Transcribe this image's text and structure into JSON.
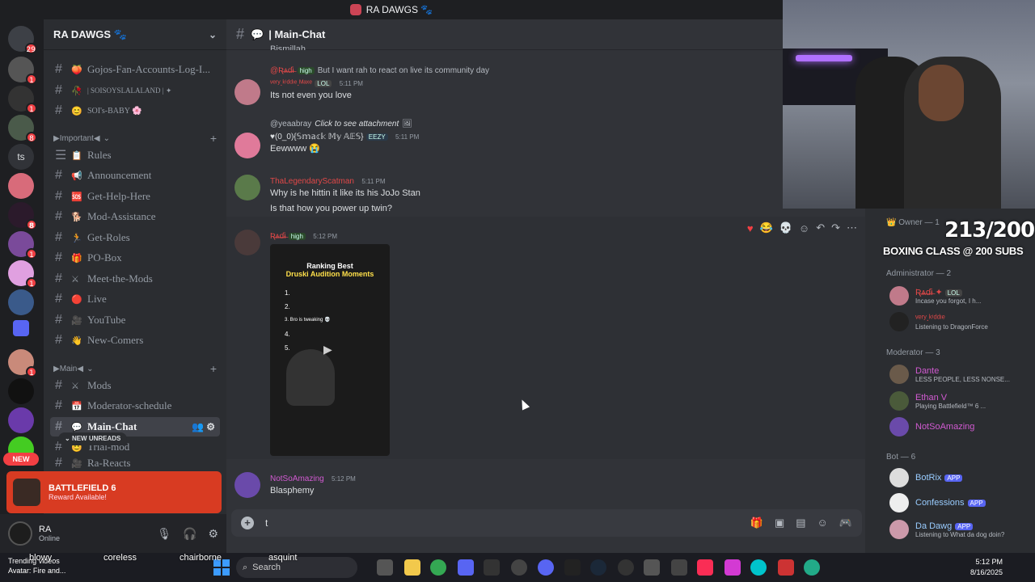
{
  "window": {
    "server_title": "RA DAWGS 🐾"
  },
  "servers": [
    {
      "badge": "29"
    },
    {
      "badge": "1"
    },
    {
      "badge": "1"
    },
    {
      "badge": "8"
    },
    {
      "badge": ""
    },
    {
      "badge": ""
    },
    {
      "badge": "8"
    },
    {
      "badge": "1"
    },
    {
      "badge": "1"
    },
    {
      "badge": ""
    },
    {
      "badge": ""
    },
    {
      "badge": "1"
    },
    {
      "badge": ""
    },
    {
      "badge": ""
    },
    {
      "badge": ""
    }
  ],
  "rail_text": {
    "ts": "ts",
    "new": "NEW"
  },
  "guild": {
    "name": "RA DAWGS 🐾"
  },
  "channels": [
    {
      "emoji": "🍑",
      "name": "Gojos-Fan-Accounts-Log-I..."
    },
    {
      "emoji": "🥀",
      "name": "| SOISOYSLALALAND | ✦"
    },
    {
      "emoji": "😊",
      "name": "SOI's-BABY 🌸"
    }
  ],
  "cat_important": "▶Important◀",
  "important_channels": [
    {
      "emoji": "📋",
      "name": "Rules"
    },
    {
      "emoji": "📢",
      "name": "Announcement"
    },
    {
      "emoji": "🆘",
      "name": "Get-Help-Here"
    },
    {
      "emoji": "🐕",
      "name": "Mod-Assistance"
    },
    {
      "emoji": "🏃",
      "name": "Get-Roles"
    },
    {
      "emoji": "🎁",
      "name": "PO-Box"
    },
    {
      "emoji": "⚔",
      "name": "Meet-the-Mods"
    },
    {
      "emoji": "🔴",
      "name": "Live"
    },
    {
      "emoji": "🎥",
      "name": "YouTube"
    },
    {
      "emoji": "👋",
      "name": "New-Comers"
    }
  ],
  "cat_main": "▶Main◀",
  "main_channels": [
    {
      "emoji": "⚔",
      "name": "Mods"
    },
    {
      "emoji": "📅",
      "name": "Moderator-schedule"
    },
    {
      "emoji": "💬",
      "name": "Main-Chat"
    },
    {
      "emoji": "😊",
      "name": "Trial-mod"
    },
    {
      "emoji": "🎥",
      "name": "Ra-Reacts"
    }
  ],
  "new_unreads": "NEW UNREADS",
  "promo": {
    "title": "BATTLEFIELD 6",
    "sub": "Reward Available!"
  },
  "user": {
    "name": "RA",
    "status": "Online"
  },
  "channel_header": "| Main-Chat",
  "messages": {
    "m0_text": "Bismillah",
    "m1_reply_user": "@Ʀ̶ѧ̶ɗ̶ɨ̶",
    "m1_reply_tag": "high",
    "m1_reply_text": "But I want rah to react on live its community day",
    "m1_user": "ᵛᵉʳʸ.ᵏⁱᵈᵈᶦᵉ.ᴹᵃˣᵉ",
    "m1_tag": "LOL",
    "m1_time": "5:11 PM",
    "m1_text": "Its not even you love",
    "m2_reply_user": "@yeaabray",
    "m2_reply_text": "Click to see attachment",
    "m2_user": "♥(0_0){𝕊𝕞𝕒𝕔𝕜 𝕄𝕪 𝔸𝔼𝕊}",
    "m2_tag": "EEZY",
    "m2_time": "5:11 PM",
    "m2_text": "Eewwww 😭",
    "m3_user": "ThaLegendaryScatman",
    "m3_time": "5:11 PM",
    "m3_text1": "Why is he hittin it like its his JoJo Stan",
    "m3_text2": "Is that how you power up twin?",
    "m4_user": "Ʀ̶ѧ̶ɗ̶ɨ̶",
    "m4_tag": "high",
    "m4_time": "5:12 PM",
    "video_title1": "Ranking Best",
    "video_title2": "Druski Audition Moments",
    "video_list": [
      "1.",
      "2.",
      "3. Bro is tweaking 💀",
      "4.",
      "5."
    ],
    "m5_user": "NotSoAmazing",
    "m5_time": "5:12 PM",
    "m5_text": "Blasphemy"
  },
  "composer": {
    "value": "t"
  },
  "stream": {
    "subs": "213/200",
    "goal": "BOXING CLASS @ 200 SUBS"
  },
  "members": {
    "owner_role": "👑 Owner — 1",
    "admin_role": "Administrator — 2",
    "admin1_name": "Ʀ̶ѧ̶ɗ̶ɨ̶ ✦",
    "admin1_tag": "LOL",
    "admin1_act": "Incase you forgot, I h...",
    "admin2_name": "ᵛᵉʳʸ.ᵏⁱᵈᵈᶦᵉ",
    "admin2_act": "Listening to DragonForce",
    "mod_role": "Moderator — 3",
    "mod1_name": "Dante",
    "mod1_act": "LESS PEOPLE, LESS NONSE...",
    "mod2_name": "Ethan V",
    "mod2_act": "Playing Battlefield™ 6 ...",
    "mod3_name": "NotSoAmazing",
    "bot_role": "Bot — 6",
    "bot1_name": "BotRix",
    "bot2_name": "Confessions",
    "bot3_name": "Da Dawg",
    "bot3_act": "Listening to What da dog doin?",
    "app_label": "APP"
  },
  "taskbar": {
    "widget1": "Trending videos",
    "widget2": "Avatar: Fire and...",
    "search": "Search",
    "time": "5:12 PM",
    "date": "8/16/2025",
    "overlay_words": [
      "blowy",
      "coreless",
      "chairborne",
      "asquint"
    ]
  },
  "colors": {
    "accent": "#5865f2",
    "danger": "#f23f43",
    "promo": "#d83b22"
  }
}
